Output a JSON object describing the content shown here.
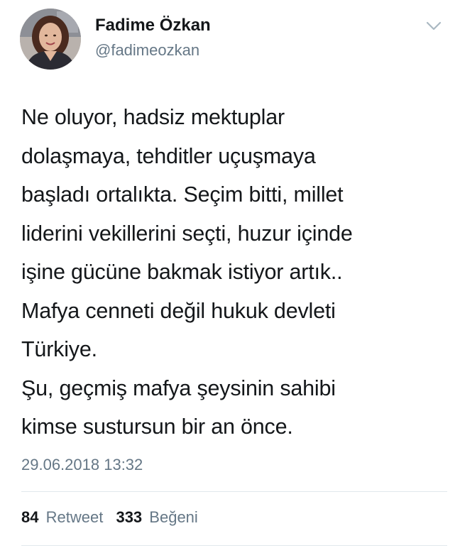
{
  "author": {
    "display_name": "Fadime Özkan",
    "handle": "@fadimeozkan",
    "avatar_icon": "profile-photo"
  },
  "menu": {
    "icon": "chevron-down-icon"
  },
  "tweet": {
    "text": "Ne oluyor, hadsiz mektuplar\ndolaşmaya, tehditler uçuşmaya\nbaşladı ortalıkta. Seçim bitti, millet\nliderini vekillerini seçti, huzur içinde\nişine gücüne bakmak istiyor artık..\nMafya cenneti değil hukuk devleti\nTürkiye.\nŞu, geçmiş mafya şeysinin sahibi\nkimse sustursun bir an önce.",
    "timestamp": "29.06.2018 13:32"
  },
  "stats": {
    "retweets": {
      "count": "84",
      "label": "Retweet"
    },
    "likes": {
      "count": "333",
      "label": "Beğeni"
    }
  },
  "colors": {
    "text": "#14171a",
    "secondary": "#657786",
    "divider": "#e1e8ed"
  }
}
